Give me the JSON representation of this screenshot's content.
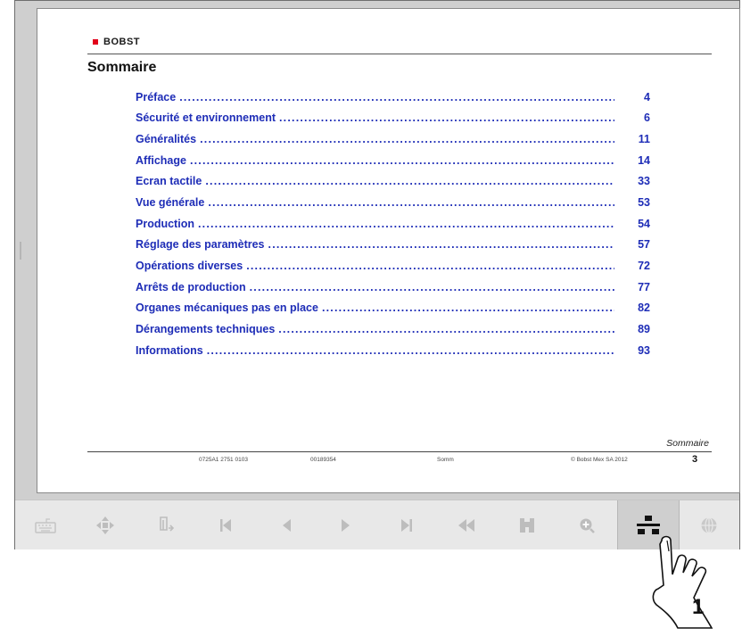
{
  "document": {
    "brand": "BOBST",
    "title": "Sommaire",
    "toc": [
      {
        "label": "Préface",
        "page": "4"
      },
      {
        "label": "Sécurité et environnement",
        "page": "6"
      },
      {
        "label": "Généralités",
        "page": "11"
      },
      {
        "label": "Affichage",
        "page": "14"
      },
      {
        "label": "Ecran tactile",
        "page": "33"
      },
      {
        "label": "Vue générale",
        "page": "53"
      },
      {
        "label": "Production",
        "page": "54"
      },
      {
        "label": "Réglage des paramètres",
        "page": "57"
      },
      {
        "label": "Opérations diverses",
        "page": "72"
      },
      {
        "label": "Arrêts de production",
        "page": "77"
      },
      {
        "label": "Organes mécaniques pas en place",
        "page": "82"
      },
      {
        "label": "Dérangements techniques",
        "page": "89"
      },
      {
        "label": "Informations",
        "page": "93"
      }
    ],
    "section_label": "Sommaire",
    "footer": {
      "ref1": "0725A1 2751 0103",
      "ref2": "00189354",
      "ref3": "Somm",
      "copyright": "© Bobst Mex SA 2012",
      "page_number": "3"
    }
  },
  "toolbar": {
    "buttons": [
      {
        "icon": "keyboard-icon"
      },
      {
        "icon": "move-arrows-icon"
      },
      {
        "icon": "export-icon"
      },
      {
        "icon": "first-page-icon"
      },
      {
        "icon": "previous-page-icon"
      },
      {
        "icon": "next-page-icon"
      },
      {
        "icon": "last-page-icon"
      },
      {
        "icon": "back-icon"
      },
      {
        "icon": "machine-icon"
      },
      {
        "icon": "zoom-in-icon"
      },
      {
        "icon": "table-of-contents-icon",
        "active": true
      },
      {
        "icon": "globe-icon"
      }
    ]
  },
  "callout": {
    "label": "1"
  },
  "colors": {
    "link": "#1e2db7",
    "brand": "#e2001a",
    "toolbar_bg": "#e8e8e8",
    "icon_disabled": "#bdbdbd"
  }
}
